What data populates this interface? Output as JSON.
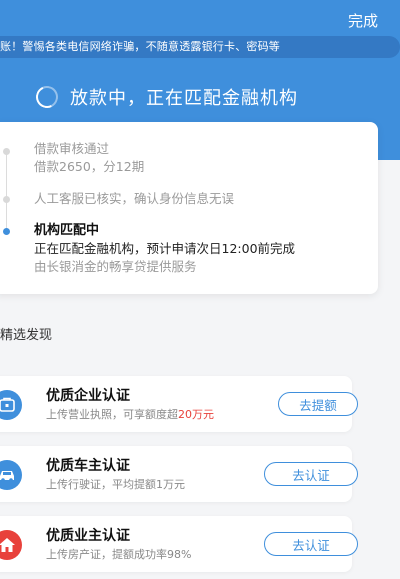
{
  "header": {
    "done_label": "完成",
    "marquee_text": "账！警惕各类电信网络诈骗，不随意透露银行卡、密码等",
    "status_title": "放款中，正在匹配金融机构"
  },
  "timeline": {
    "steps": [
      {
        "title": "借款审核通过",
        "desc": "借款2650，分12期"
      },
      {
        "title": "人工客服已核实，确认身份信息无误"
      },
      {
        "title": "机构匹配中",
        "desc": "正在匹配金融机构，预计申请次日12:00前完成",
        "note": "由长银消金的畅享贷提供服务"
      }
    ]
  },
  "discover": {
    "section_title": "精选发现",
    "cards": [
      {
        "title": "优质企业认证",
        "desc": "上传营业执照，可享额度超",
        "highlight": "20万元",
        "button": "去提额",
        "icon": "enterprise-icon",
        "icon_color": "#3f8fdc"
      },
      {
        "title": "优质车主认证",
        "desc": "上传行驶证，平均提额1万元",
        "button": "去认证",
        "icon": "car-icon",
        "icon_color": "#3f8fdc"
      },
      {
        "title": "优质业主认证",
        "desc": "上传房产证，提额成功率98%",
        "button": "去认证",
        "icon": "house-icon",
        "icon_color": "#e8413b"
      }
    ]
  },
  "colors": {
    "brand_blue": "#3f8fdc",
    "highlight_red": "#e8413b"
  }
}
